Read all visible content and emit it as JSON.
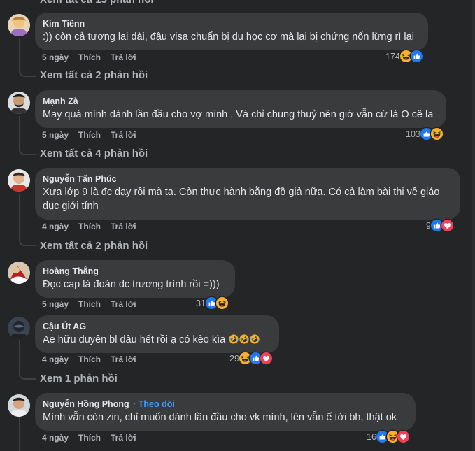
{
  "top_partial": "Xem tất cả 15 phản hồi",
  "comments": [
    {
      "name": "Kim Tiềnn",
      "text": ":)) còn cả tương lai dài, đậu visa chuẩn bị du học cơ mà lại bị chứng nốn lừng rì lại",
      "time": "5 ngày",
      "like": "Thích",
      "reply": "Trả lời",
      "reaction_count": "174",
      "reactions": [
        "haha",
        "like"
      ],
      "view_replies": "Xem tất cả 2 phản hồi"
    },
    {
      "name": "Mạnh Zà",
      "text": "May quá mình dành lần đầu cho vợ mình . Và chỉ chung thuỷ nên giờ vẫn cứ là O cê la",
      "time": "5 ngày",
      "like": "Thích",
      "reply": "Trả lời",
      "reaction_count": "103",
      "reactions": [
        "like",
        "haha"
      ],
      "view_replies": "Xem tất cả 4 phản hồi"
    },
    {
      "name": "Nguyễn Tấn Phúc",
      "text_line1": "Xưa lớp 9 là đc dạy rồi mà ta. Còn thực hành bằng đồ giả nữa. Có cả làm bài thi về giáo",
      "text_line2": "dục giới tính",
      "time": "4 ngày",
      "like": "Thích",
      "reply": "Trả lời",
      "reaction_count": "9",
      "reactions": [
        "like",
        "love"
      ],
      "view_replies": "Xem tất cả 2 phản hồi"
    },
    {
      "name": "Hoàng Thắng",
      "text": "Đọc cap là đoán dc trương trình rồi =)))",
      "time": "5 ngày",
      "like": "Thích",
      "reply": "Trả lời",
      "reaction_count": "31",
      "reactions": [
        "like",
        "haha"
      ]
    },
    {
      "name": "Cậu Út AG",
      "text": "Ae hữu duyên bl đâu hết rồi ạ có kèo kìa",
      "text_emojis": [
        "rofl",
        "rofl",
        "rofl"
      ],
      "time": "4 ngày",
      "like": "Thích",
      "reply": "Trả lời",
      "reaction_count": "29",
      "reactions": [
        "haha",
        "like",
        "love"
      ],
      "view_replies": "Xem 1 phản hồi"
    },
    {
      "name": "Nguyễn Hồng Phong",
      "follow": "Theo dõi",
      "text": "Mình vẫn còn zin, chỉ muốn dành lần đầu cho vk mình, lên vẫn ế tới bh, thật ok",
      "time": "4 ngày",
      "like": "Thích",
      "reply": "Trả lời",
      "reaction_count": "16",
      "reactions": [
        "like",
        "haha",
        "love"
      ]
    }
  ],
  "colors": {
    "background": "#242526",
    "bubble": "#3a3b3c",
    "link": "#4599ff",
    "like": "#2078f4",
    "love": "#f33e58",
    "haha": "#f7b125"
  }
}
